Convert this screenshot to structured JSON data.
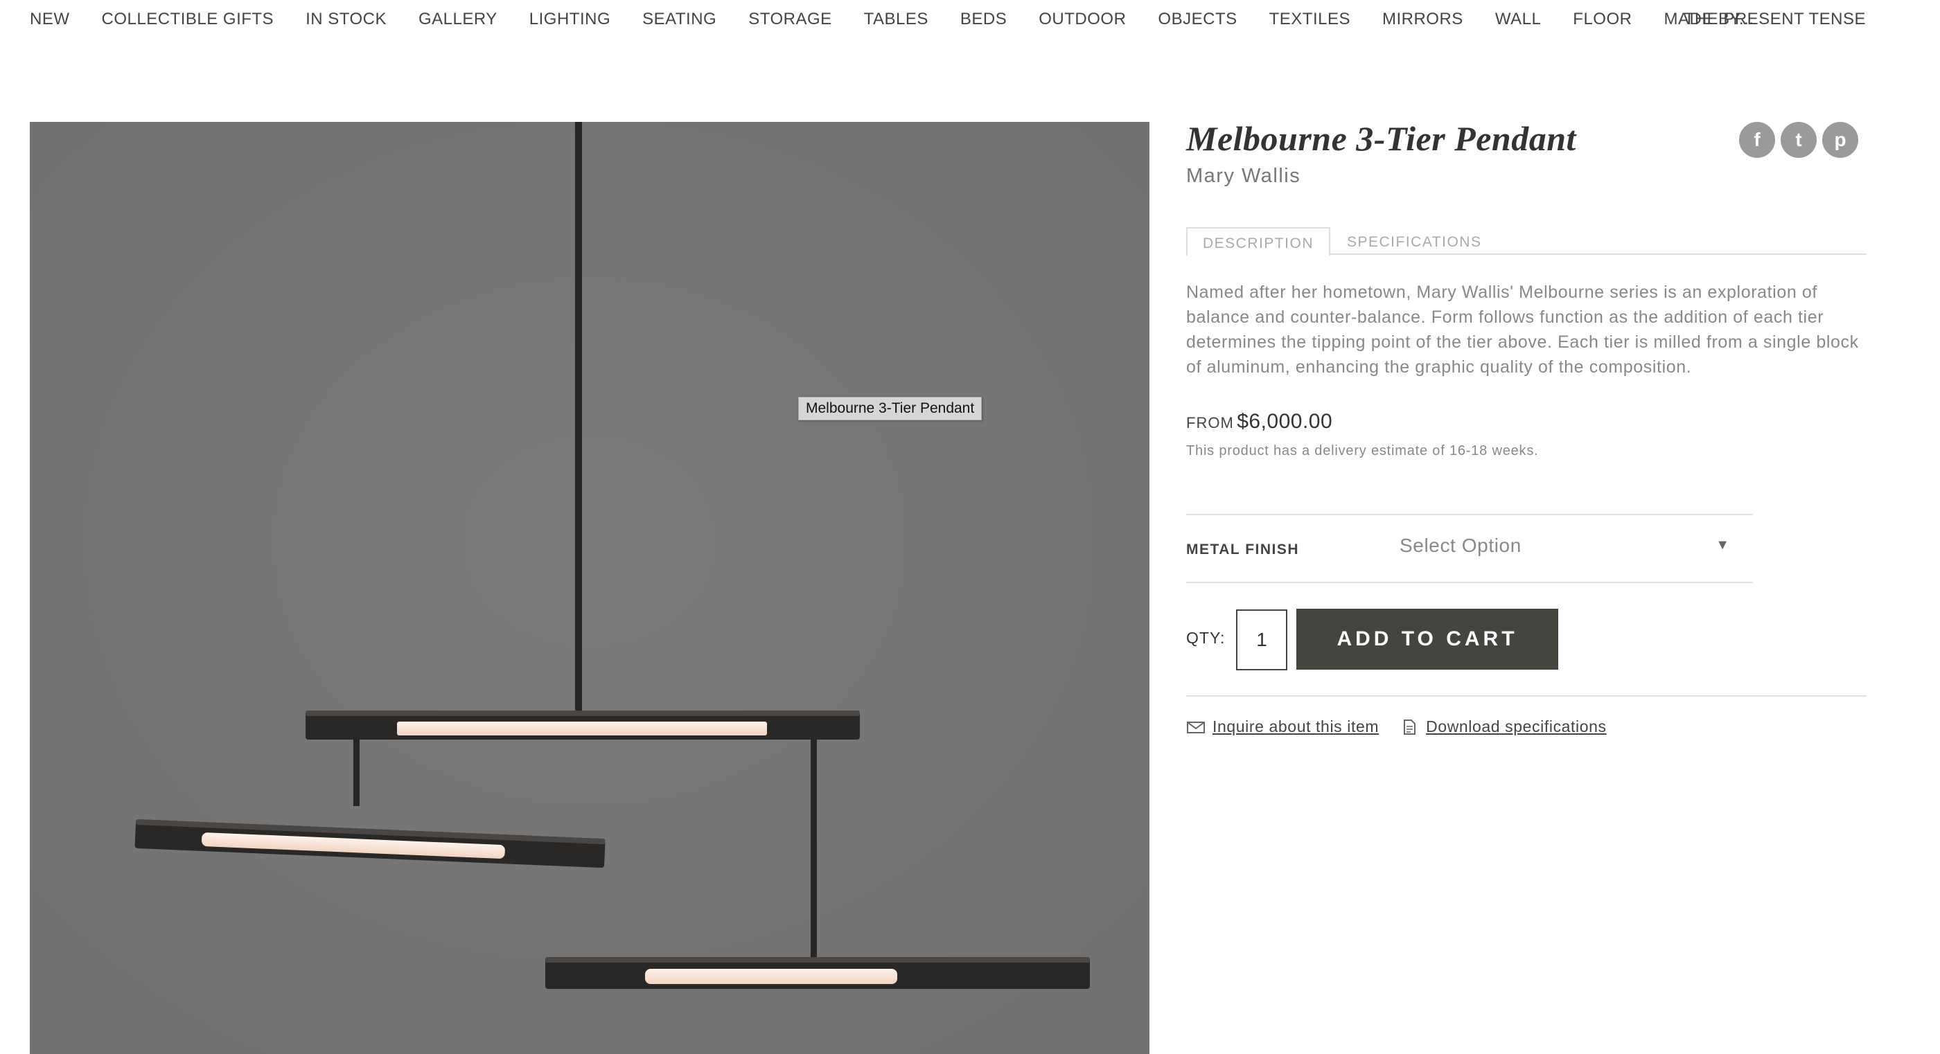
{
  "nav": {
    "items": [
      "NEW",
      "COLLECTIBLE GIFTS",
      "IN STOCK",
      "GALLERY",
      "LIGHTING",
      "SEATING",
      "STORAGE",
      "TABLES",
      "BEDS",
      "OUTDOOR",
      "OBJECTS",
      "TEXTILES",
      "MIRRORS",
      "WALL",
      "FLOOR",
      "MADE BY..."
    ],
    "brand": "THE PRESENT TENSE"
  },
  "product": {
    "title": "Melbourne 3-Tier Pendant",
    "designer": "Mary Wallis",
    "image_tooltip": "Melbourne 3-Tier Pendant",
    "image_background": "#767676",
    "tabs": [
      "DESCRIPTION",
      "SPECIFICATIONS"
    ],
    "active_tab": "DESCRIPTION",
    "description": "Named after her hometown, Mary Wallis' Melbourne series is an exploration of balance and counter-balance. Form follows function as the addition of each tier determines the tipping point of the tier above. Each tier is milled from a single block of aluminum, enhancing the graphic quality of the composition.",
    "price_prefix": "FROM",
    "price": "$6,000.00",
    "delivery": "This product has a delivery estimate of 16-18 weeks."
  },
  "share": {
    "icons": [
      "facebook-icon",
      "twitter-icon",
      "pinterest-icon"
    ],
    "glyphs": [
      "f",
      "t",
      "p"
    ]
  },
  "options": {
    "metal_finish_label": "METAL FINISH",
    "metal_finish_value": "Select Option"
  },
  "cart": {
    "qty_label": "QTY:",
    "qty_value": "1",
    "add_label": "ADD TO CART",
    "button_color": "#454540"
  },
  "links": {
    "inquire": "Inquire about this item",
    "download": "Download specifications"
  }
}
